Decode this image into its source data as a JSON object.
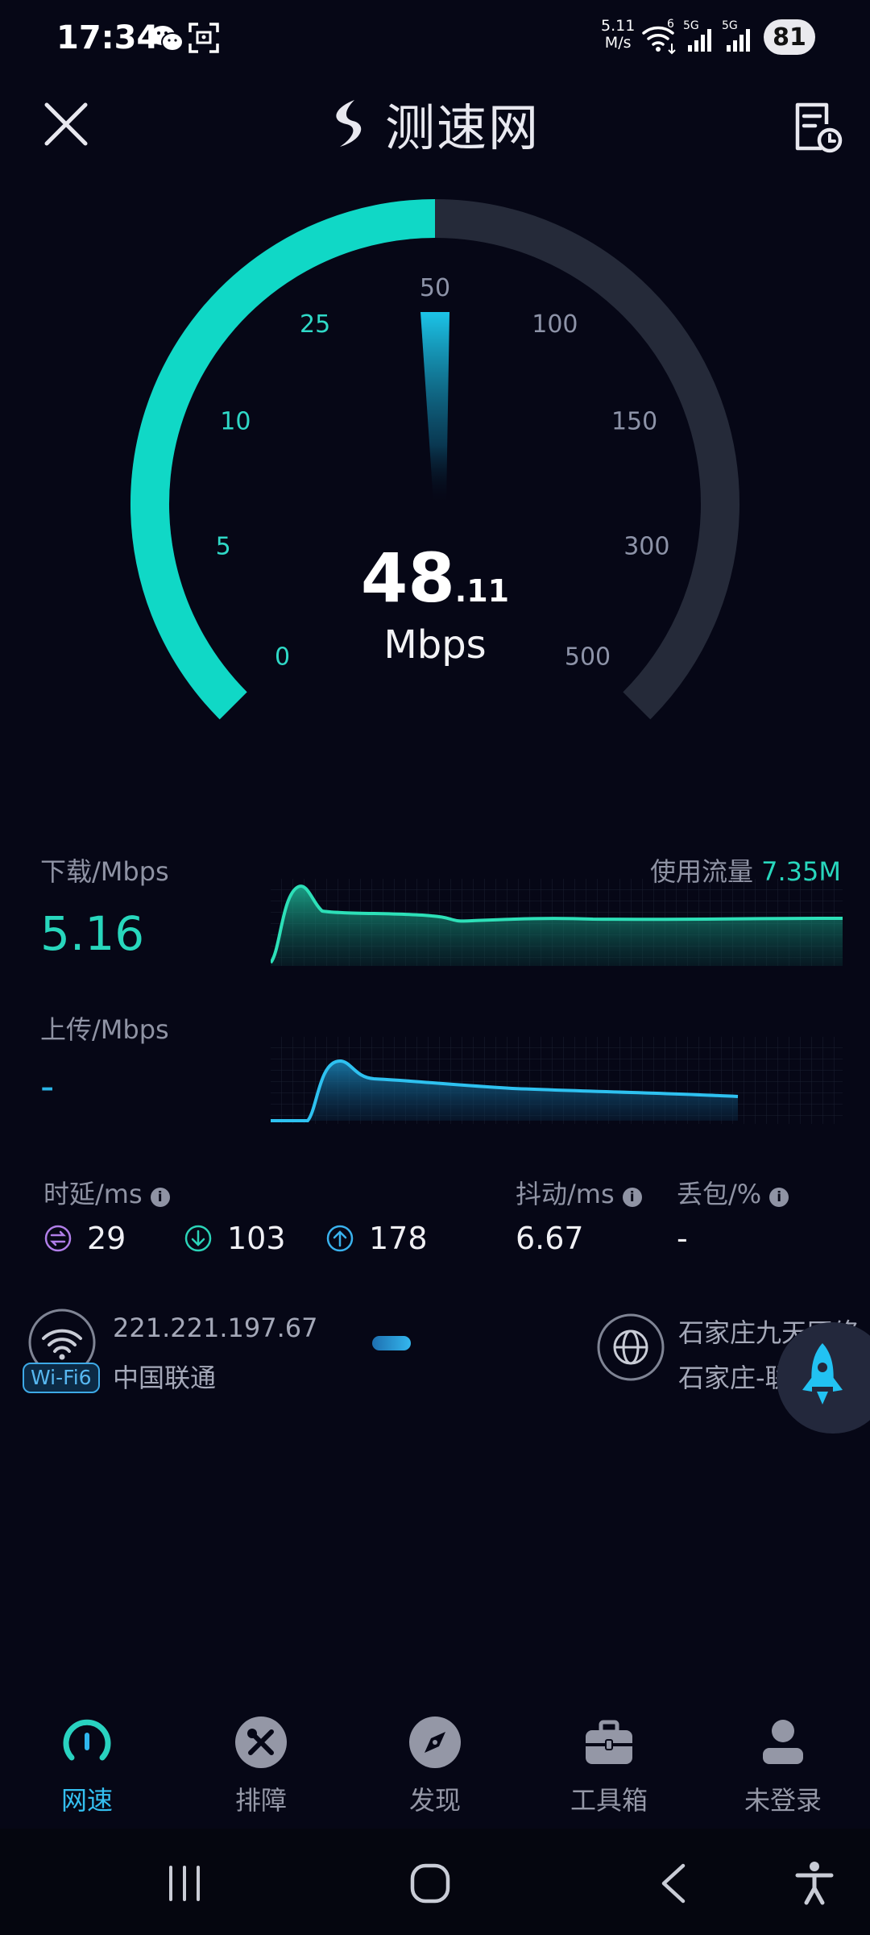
{
  "status_bar": {
    "time": "17:34",
    "net_speed_value": "5.11",
    "net_speed_unit": "M/s",
    "wifi_label": "6",
    "signal1_label": "5G",
    "signal2_label": "5G",
    "battery": "81"
  },
  "header": {
    "logo_text": "测速网",
    "close_icon": "close-icon",
    "history_icon": "history-icon"
  },
  "gauge": {
    "ticks": [
      "0",
      "5",
      "10",
      "25",
      "50",
      "100",
      "150",
      "300",
      "500"
    ],
    "progress_fraction": 0.5,
    "speed_integer": "48",
    "speed_decimal": ".11",
    "unit": "Mbps",
    "colors": {
      "active": "#10d8c6",
      "track": "#252a39"
    }
  },
  "download": {
    "label": "下载/Mbps",
    "value": "5.16",
    "usage_label": "使用流量",
    "usage_value": "7.35M",
    "color": "#28d7bd"
  },
  "upload": {
    "label": "上传/Mbps",
    "value": "-",
    "color": "#2bb6e8"
  },
  "latency": {
    "label": "时延/ms",
    "idle": "29",
    "down": "103",
    "up": "178",
    "jitter_label": "抖动/ms",
    "jitter": "6.67",
    "loss_label": "丢包/%",
    "loss": "-",
    "info_glyph": "i"
  },
  "connection": {
    "wifi_badge": "Wi-Fi6",
    "ip": "221.221.197.67",
    "isp": "中国联通",
    "server_line1": "石家庄九天网络",
    "server_line2": "石家庄-联通"
  },
  "bottom_nav": {
    "items": [
      {
        "label": "网速",
        "icon": "speed-gauge-icon",
        "active": true
      },
      {
        "label": "排障",
        "icon": "tools-icon",
        "active": false
      },
      {
        "label": "发现",
        "icon": "compass-icon",
        "active": false
      },
      {
        "label": "工具箱",
        "icon": "toolbox-icon",
        "active": false
      },
      {
        "label": "未登录",
        "icon": "user-icon",
        "active": false
      }
    ]
  }
}
